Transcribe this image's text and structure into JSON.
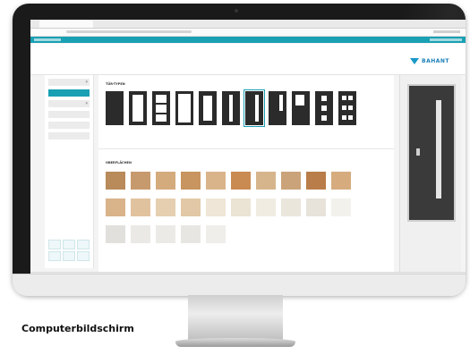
{
  "caption": "Computerbildschirm",
  "brand": {
    "name": "BAHANT",
    "accent": "#1aa0b3",
    "logo_color": "#1a7fb8"
  },
  "sections": {
    "door_types": "TÜR-TYPEN",
    "surfaces": "OBERFLÄCHEN"
  },
  "colors": {
    "swatches_row1": [
      "#b98a5a",
      "#c79a6e",
      "#d4ab7d",
      "#c8945f",
      "#d9b48a",
      "#c98b52",
      "#d7b58c",
      "#caa37a",
      "#b97d49",
      "#d6ac7f"
    ],
    "swatches_row2": [
      "#d9b38a",
      "#e1c29e",
      "#e6cfb0",
      "#e2c8a6",
      "#efe6d7",
      "#ebe3d4",
      "#f1ece2",
      "#ebe6dc",
      "#e7e3da",
      "#f3f1ec"
    ],
    "swatches_row3": [
      "#e2e0dc",
      "#ebe9e5",
      "#eceae6",
      "#e8e6e2",
      "#f0eeea"
    ]
  }
}
